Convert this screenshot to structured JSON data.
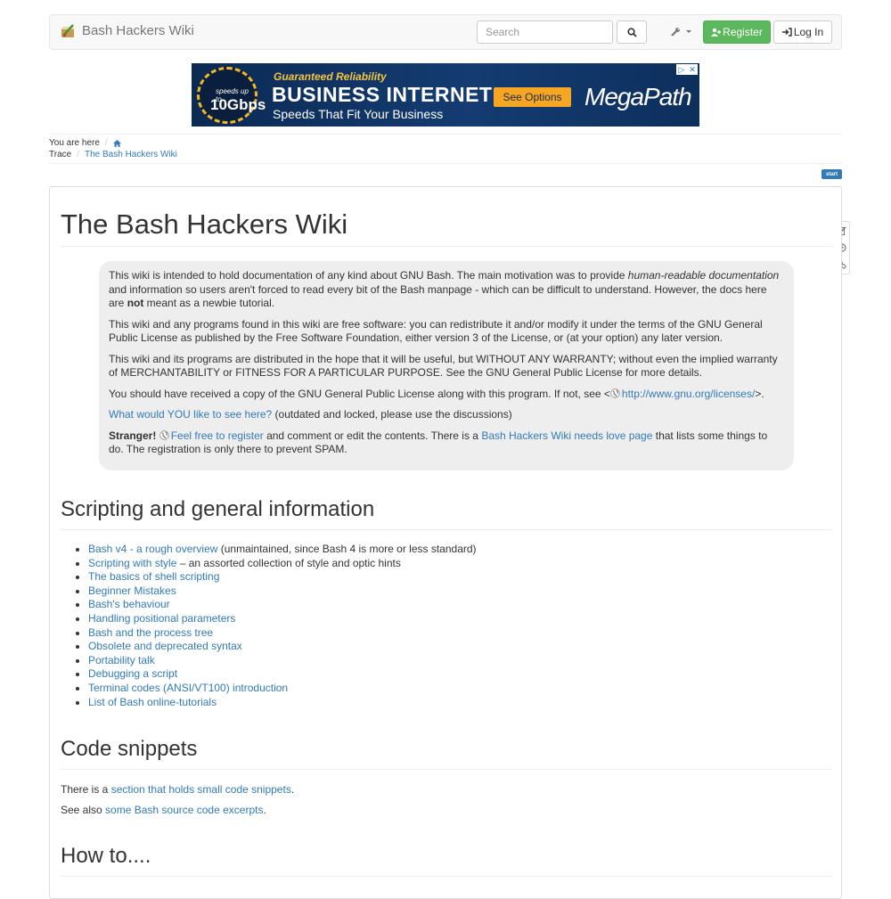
{
  "navbar": {
    "brand_title": "Bash Hackers Wiki",
    "search_placeholder": "Search",
    "register_label": "Register",
    "login_label": "Log In"
  },
  "ad": {
    "badge_small": "speeds up to",
    "badge_big": "10Gbps",
    "kicker": "Guaranteed Reliability",
    "headline": "BUSINESS INTERNET",
    "sub": "Speeds That Fit Your Business",
    "cta": "See Options",
    "brand": "MegaPath"
  },
  "breadcrumbs": {
    "you_are_here_label": "You are here",
    "trace_label": "Trace",
    "trace_item": "The Bash Hackers Wiki"
  },
  "page_id_badge": "start",
  "page": {
    "title": "The Bash Hackers Wiki"
  },
  "intro": {
    "p1_a": "This wiki is intended to hold documentation of any kind about GNU Bash. The main motivation was to provide ",
    "p1_em": "human-readable documentation",
    "p1_b": " and information so users aren't forced to read every bit of the Bash manpage - which can be difficult to understand. However, the docs here are ",
    "p1_strong": "not",
    "p1_c": " meant as a newbie tutorial.",
    "p2": "This wiki and any programs found in this wiki are free software: you can redistribute it and/or modify it under the terms of the GNU General Public License as published by the Free Software Foundation, either version 3 of the License, or (at your option) any later version.",
    "p3": "This wiki and its programs are distributed in the hope that it will be useful, but WITHOUT ANY WARRANTY; without even the implied warranty of MERCHANTABILITY or FITNESS FOR A PARTICULAR PURPOSE. See the GNU General Public License for more details.",
    "p4_a": "You should have received a copy of the GNU General Public License along with this program. If not, see <",
    "p4_link": "http://www.gnu.org/licenses/",
    "p4_b": ">.",
    "p5_link": "What would YOU like to see here?",
    "p5_rest": " (outdated and locked, please use the discussions)",
    "p6_strong": "Stranger!",
    "p6_link1": "Feel free to register",
    "p6_a": " and comment or edit the contents. There is a ",
    "p6_link2": "Bash Hackers Wiki needs love page",
    "p6_b": " that lists some things to do. The registration is only there to prevent SPAM."
  },
  "section_scripting": {
    "title": "Scripting and general information",
    "items": [
      {
        "link": "Bash v4 - a rough overview",
        "note": " (unmaintained, since Bash 4 is more or less standard)"
      },
      {
        "link": "Scripting with style",
        "note": " – an assorted collection of style and optic hints"
      },
      {
        "link": "The basics of shell scripting",
        "note": ""
      },
      {
        "link": "Beginner Mistakes",
        "note": ""
      },
      {
        "link": "Bash's behaviour",
        "note": ""
      },
      {
        "link": "Handling positional parameters",
        "note": ""
      },
      {
        "link": "Bash and the process tree",
        "note": ""
      },
      {
        "link": "Obsolete and deprecated syntax",
        "note": ""
      },
      {
        "link": "Portability talk",
        "note": ""
      },
      {
        "link": "Debugging a script",
        "note": ""
      },
      {
        "link": "Terminal codes (ANSI/VT100) introduction",
        "note": ""
      },
      {
        "link": "List of Bash online-tutorials",
        "note": ""
      }
    ]
  },
  "section_snippets": {
    "title": "Code snippets",
    "p1_a": "There is a ",
    "p1_link": "section that holds small code snippets",
    "p1_b": ".",
    "p2_a": "See also ",
    "p2_link": "some Bash source code excerpts",
    "p2_b": "."
  },
  "section_howto": {
    "title": "How to...."
  }
}
